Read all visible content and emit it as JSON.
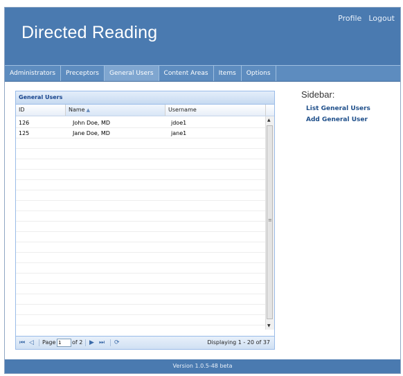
{
  "header": {
    "app_title": "Directed Reading",
    "links": {
      "profile": "Profile",
      "logout": "Logout"
    }
  },
  "nav": {
    "tabs": [
      {
        "label": "Administrators"
      },
      {
        "label": "Preceptors"
      },
      {
        "label": "General Users",
        "active": true
      },
      {
        "label": "Content Areas"
      },
      {
        "label": "Items"
      },
      {
        "label": "Options"
      }
    ]
  },
  "grid": {
    "title": "General Users",
    "columns": {
      "id": "ID",
      "name": "Name",
      "username": "Username"
    },
    "rows": [
      {
        "id": "126",
        "name": "John Doe, MD",
        "username": "jdoe1"
      },
      {
        "id": "125",
        "name": "Jane Doe, MD",
        "username": "jane1"
      }
    ],
    "paging": {
      "page_label": "Page",
      "page_value": "1",
      "of_label": "of 2",
      "display_text": "Displaying 1 - 20 of 37"
    }
  },
  "sidebar": {
    "title": "Sidebar:",
    "links": {
      "list": "List General Users",
      "add": "Add General User"
    }
  },
  "footer": {
    "version": "Version 1.0.5-48 beta"
  },
  "colors": {
    "brand": "#4a7ab0",
    "nav": "#5d8cbf",
    "grid_title": "#15428b"
  }
}
